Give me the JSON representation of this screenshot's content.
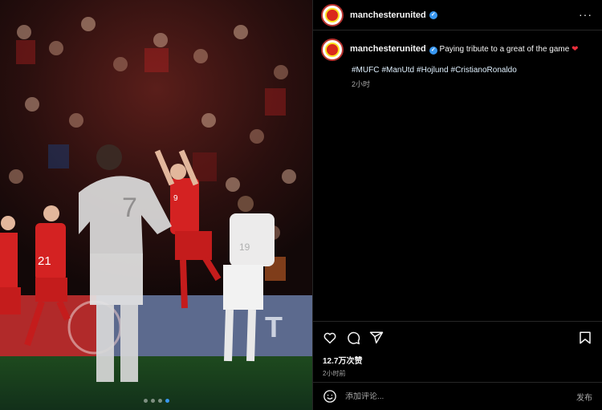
{
  "post": {
    "username": "manchesterunited",
    "verified_icon": "verified-badge-icon",
    "more_icon": "more-options-icon",
    "more_label": "···"
  },
  "caption": {
    "username": "manchesterunited",
    "text": "Paying tribute to a great of the game",
    "emoji": "❤",
    "hashtags": [
      "#MUFC",
      "#ManUtd",
      "#Hojlund",
      "#CristianoRonaldo"
    ],
    "time": "2小时"
  },
  "media": {
    "jersey_numbers": [
      "7",
      "9",
      "21",
      "19",
      "9"
    ],
    "carousel": {
      "count": 4,
      "active_index": 3
    }
  },
  "actions": {
    "icons": [
      "heart-icon",
      "comment-icon",
      "share-icon",
      "bookmark-icon"
    ],
    "likes": "12.7万次赞",
    "time": "2小时前"
  },
  "comment": {
    "placeholder": "添加评论...",
    "post_label": "发布"
  },
  "colors": {
    "background": "#000000",
    "accent": "#3897f0",
    "heart": "#ed2f3c",
    "united_red": "#da291c"
  }
}
